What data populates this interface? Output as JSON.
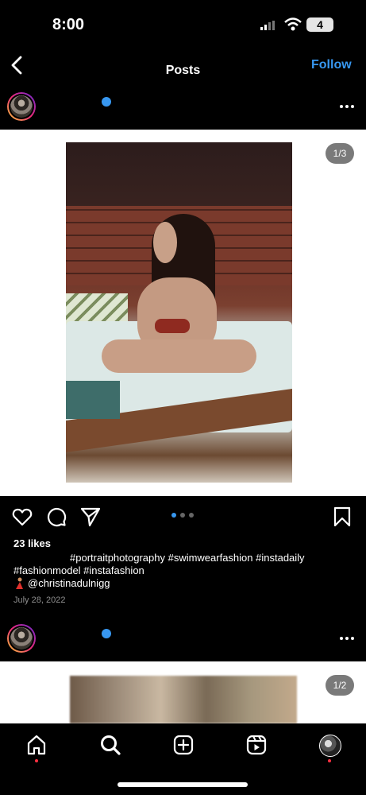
{
  "status_bar": {
    "time": "8:00",
    "battery": "4"
  },
  "header": {
    "title": "Posts",
    "follow_label": "Follow"
  },
  "post1": {
    "counter": "1/3",
    "likes": "23 likes",
    "caption_line1": "#portraitphotography #swimwearfashion #instadaily",
    "caption_line2": "#fashionmodel #instafashion",
    "mention": "@christinadulnigg",
    "date": "July 28, 2022",
    "carousel_pages": 3,
    "carousel_active": 1
  },
  "post2": {
    "counter": "1/2"
  },
  "colors": {
    "accent": "#3797f0",
    "notification": "#ff3040"
  },
  "icons": {
    "back": "chevron-left-icon",
    "more": "more-horizontal-icon",
    "like": "heart-icon",
    "comment": "comment-icon",
    "share": "paper-plane-icon",
    "save": "bookmark-icon",
    "nav": [
      "home-icon",
      "search-icon",
      "create-icon",
      "reels-icon",
      "profile-avatar"
    ]
  }
}
